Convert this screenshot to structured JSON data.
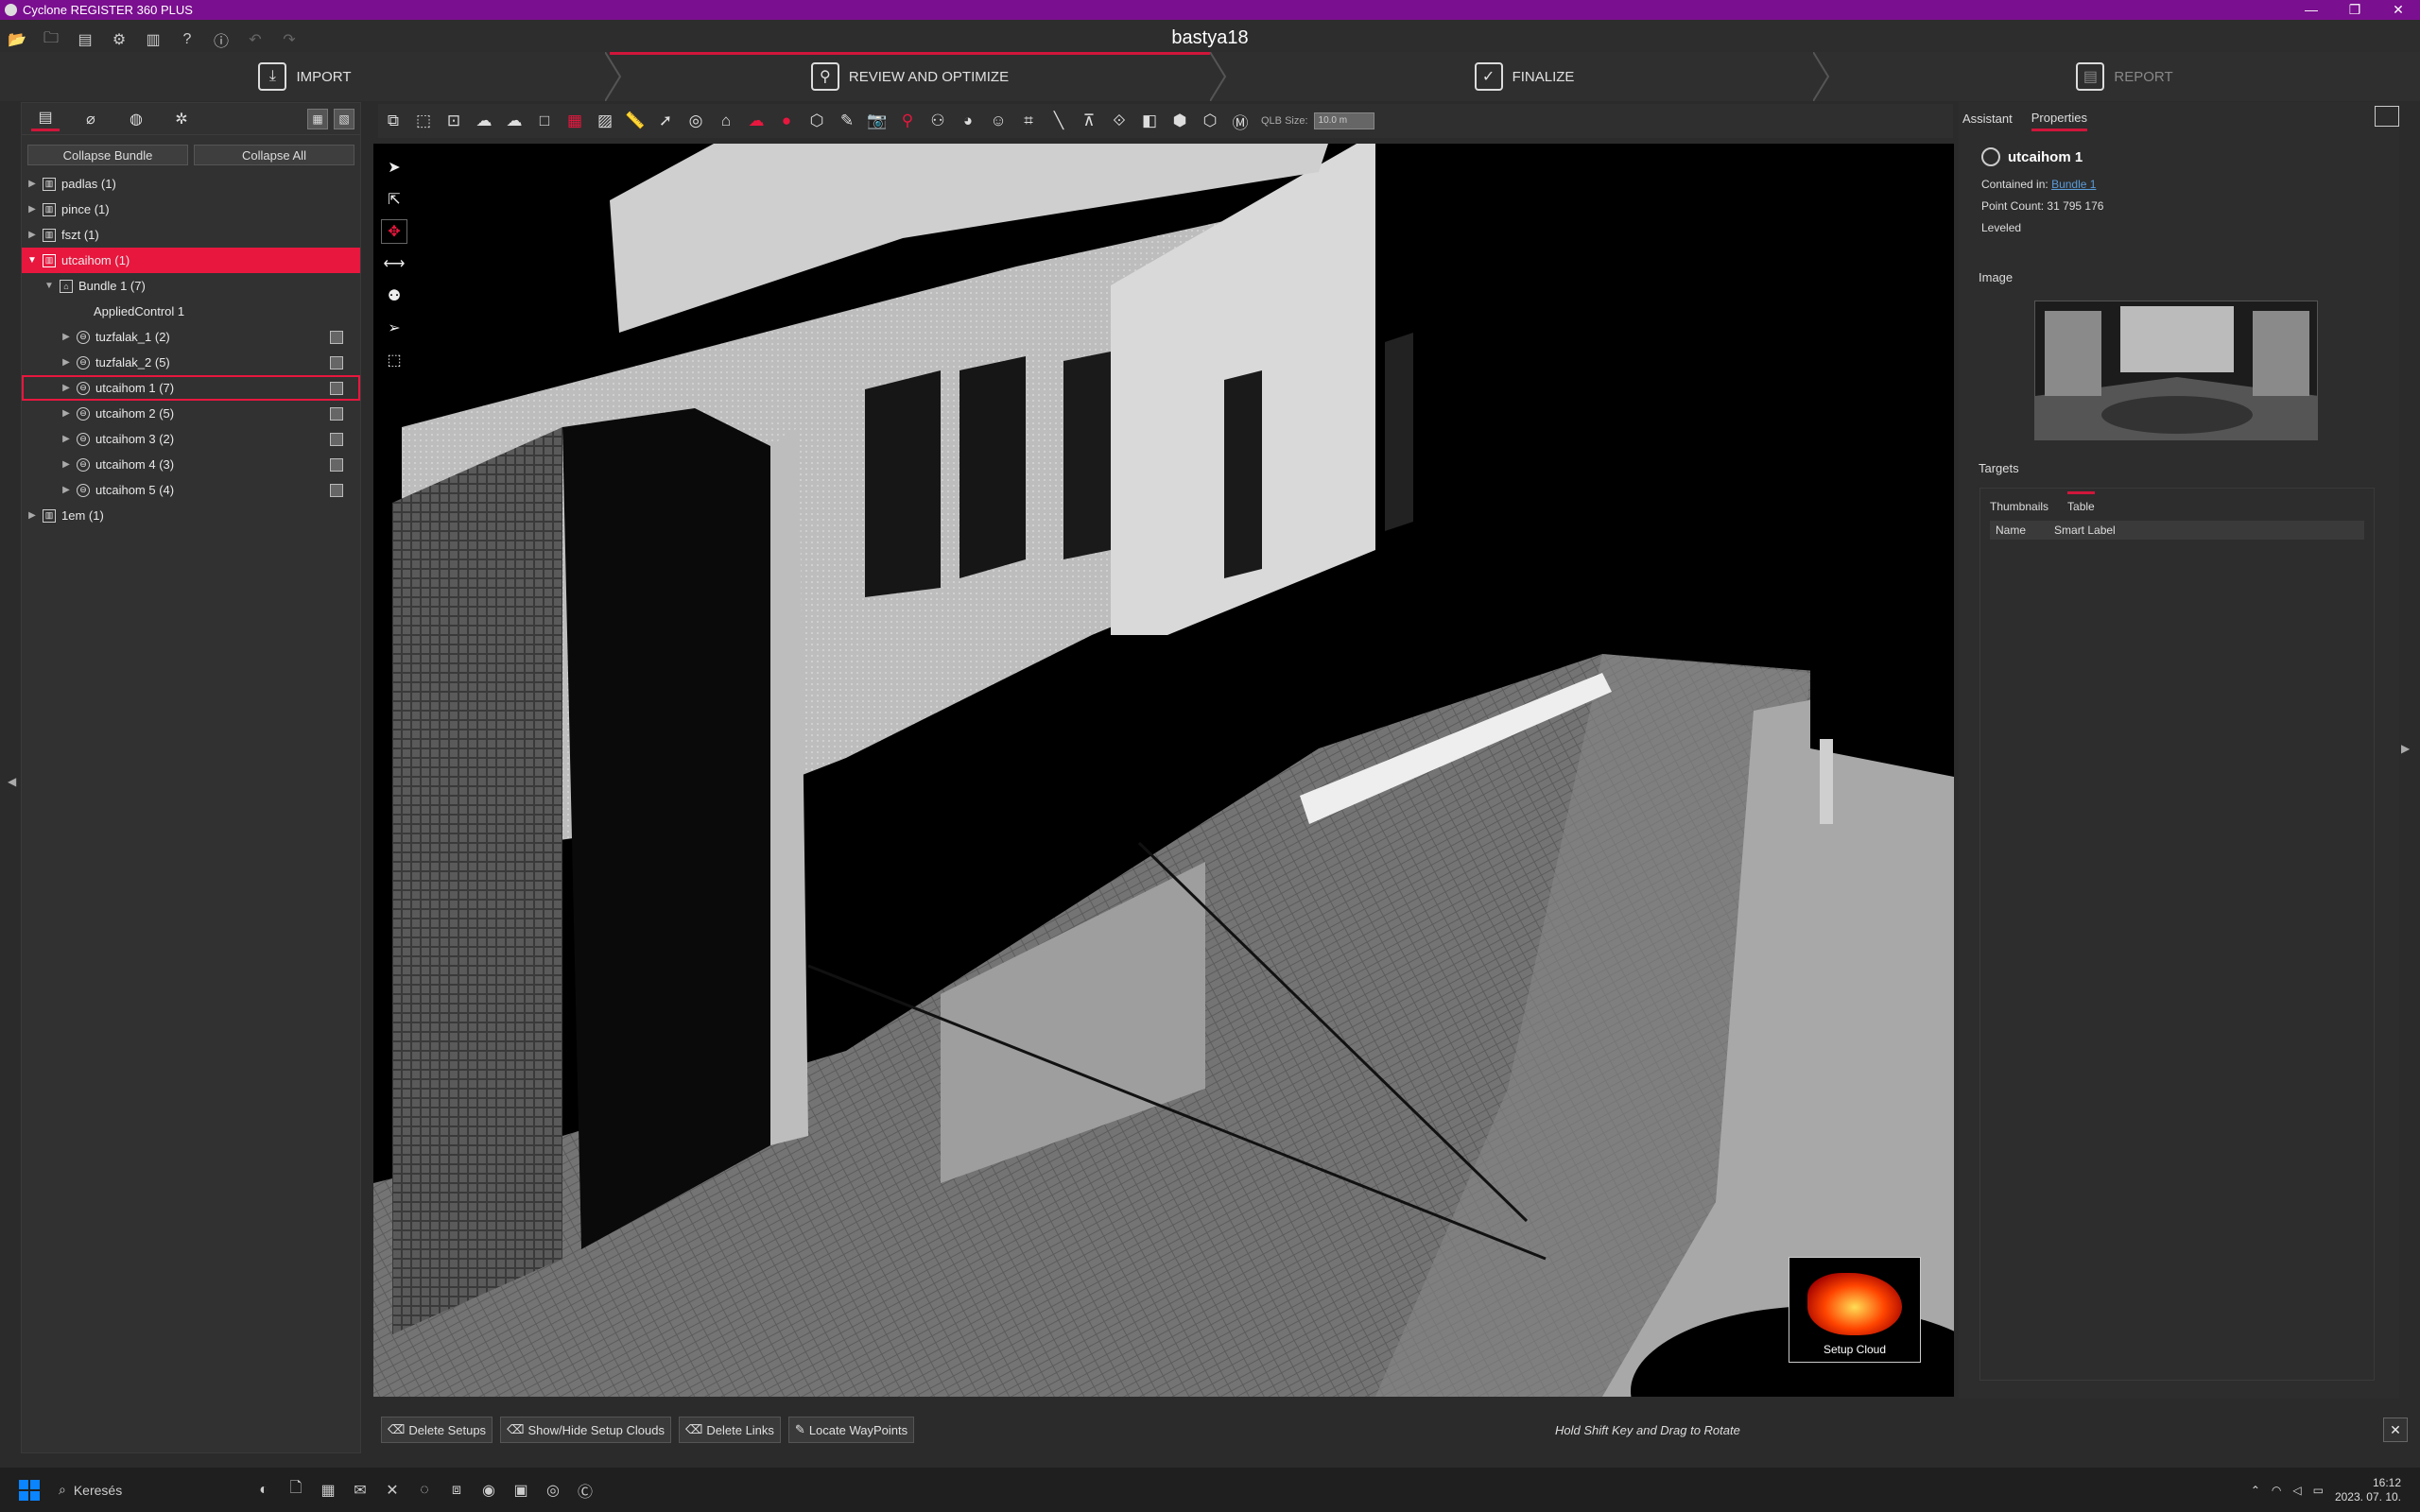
{
  "window": {
    "app_title": "Cyclone REGISTER 360 PLUS",
    "project_name": "bastya18",
    "controls": [
      "—",
      "❐",
      "✕"
    ]
  },
  "workflow": {
    "steps": [
      {
        "label": "IMPORT",
        "icon": "import-icon"
      },
      {
        "label": "REVIEW AND OPTIMIZE",
        "icon": "review-icon"
      },
      {
        "label": "FINALIZE",
        "icon": "finalize-icon"
      },
      {
        "label": "REPORT",
        "icon": "report-icon"
      }
    ],
    "active_step": "REVIEW AND OPTIMIZE",
    "accent": "#d0163a"
  },
  "left_panel": {
    "collapse_bundle": "Collapse Bundle",
    "collapse_all": "Collapse All",
    "tree": [
      {
        "label": "padlas (1)"
      },
      {
        "label": "pince (1)"
      },
      {
        "label": "fszt (1)"
      },
      {
        "label": "utcaihom (1)"
      },
      {
        "label": "Bundle 1 (7)"
      },
      {
        "label": "AppliedControl 1"
      },
      {
        "label": "tuzfalak_1 (2)"
      },
      {
        "label": "tuzfalak_2 (5)"
      },
      {
        "label": "utcaihom 1 (7)"
      },
      {
        "label": "utcaihom 2 (5)"
      },
      {
        "label": "utcaihom 3 (2)"
      },
      {
        "label": "utcaihom 4 (3)"
      },
      {
        "label": "utcaihom 5 (4)"
      },
      {
        "label": "1em (1)"
      }
    ],
    "selected_item": "utcaihom (1)",
    "highlighted_item": "utcaihom 1 (7)"
  },
  "toolbar": {
    "qlb_label": "QLB Size:",
    "qlb_value": "10.0 m"
  },
  "viewport": {
    "setup_cloud_label": "Setup Cloud"
  },
  "bottom_bar": {
    "delete_setups": "Delete Setups",
    "show_hide_setup_clouds": "Show/Hide Setup Clouds",
    "delete_links": "Delete Links",
    "locate_waypoints": "Locate WayPoints",
    "hint": "Hold Shift Key and Drag to Rotate",
    "close": "✕"
  },
  "right_panel": {
    "tabs": [
      "Assistant",
      "Properties"
    ],
    "active_tab": "Properties",
    "title": "utcaihom 1",
    "contained_in_label": "Contained in:",
    "contained_in_value": "Bundle 1",
    "point_count_label": "Point Count:",
    "point_count_value": "31 795 176",
    "leveled": "Leveled",
    "image_section": "Image",
    "targets_section": "Targets",
    "target_tabs": [
      "Thumbnails",
      "Table"
    ],
    "table_headers": [
      "Name",
      "Smart Label"
    ]
  },
  "taskbar": {
    "search": "Keresés",
    "time": "16:12",
    "date": "2023. 07. 10."
  }
}
